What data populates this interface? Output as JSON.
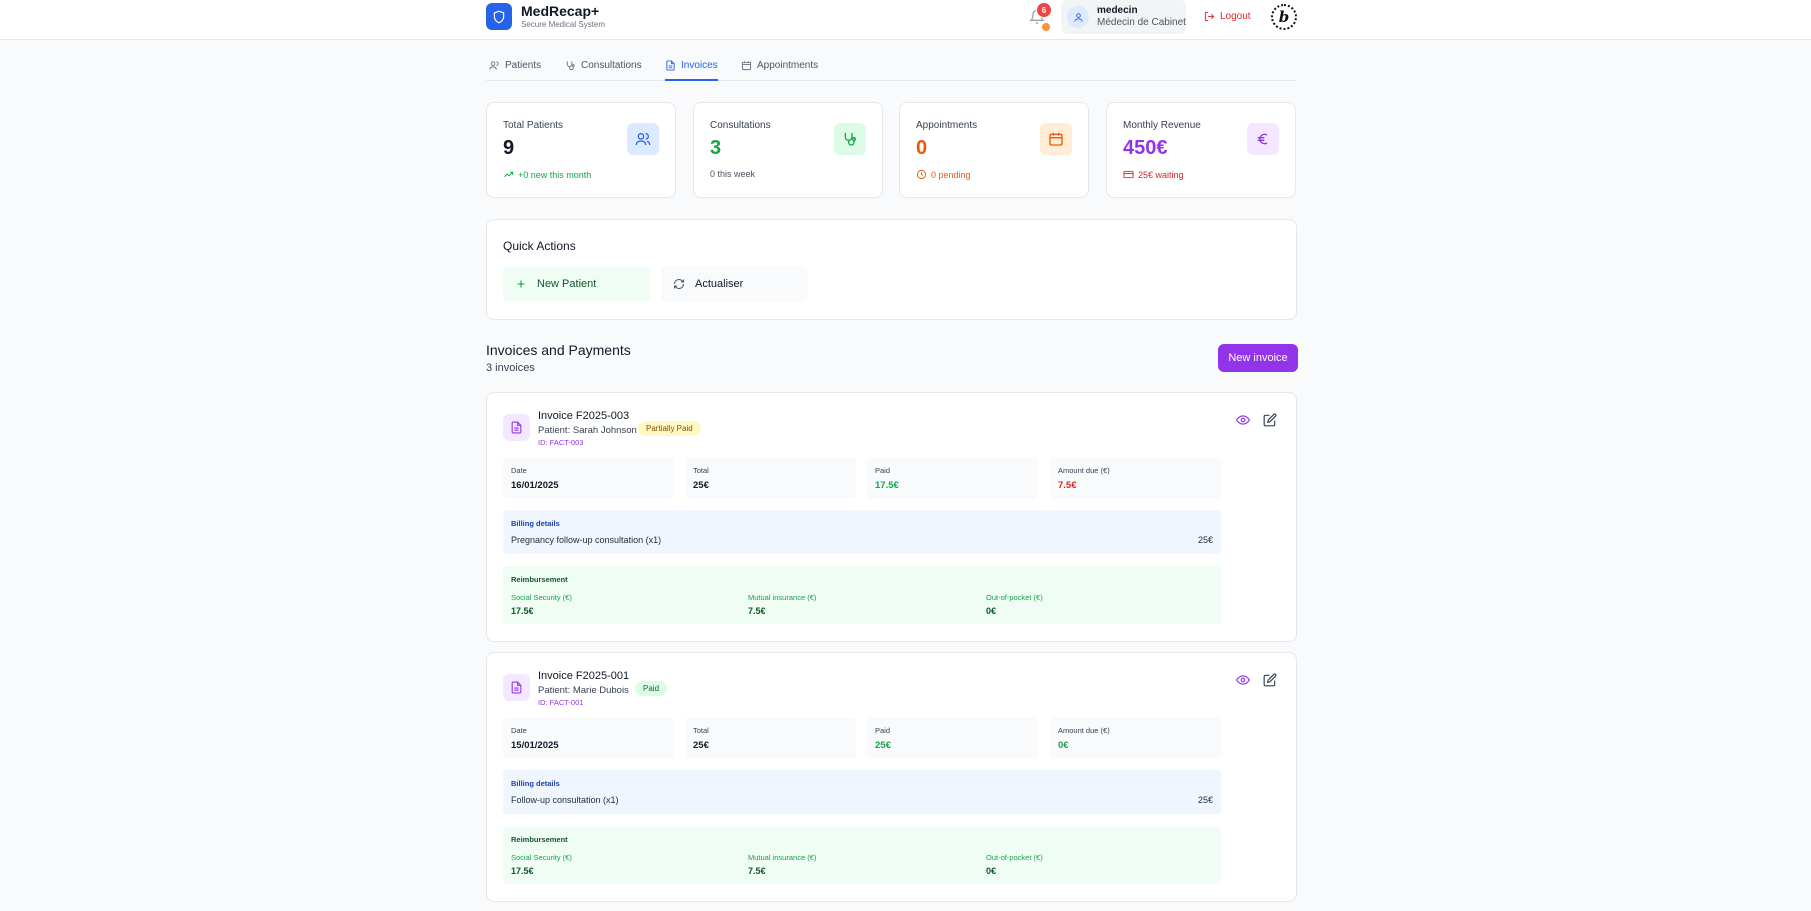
{
  "app": {
    "name": "MedRecap+",
    "subtitle": "Secure Medical System",
    "notification_count": "6"
  },
  "user": {
    "name": "medecin",
    "role": "Médecin de Cabinet",
    "logout_label": "Logout"
  },
  "tabs": [
    {
      "label": "Patients",
      "icon": "users-icon"
    },
    {
      "label": "Consultations",
      "icon": "stethoscope-icon"
    },
    {
      "label": "Invoices",
      "icon": "file-text-icon",
      "active": true
    },
    {
      "label": "Appointments",
      "icon": "calendar-icon"
    }
  ],
  "stats": [
    {
      "label": "Total Patients",
      "value": "9",
      "foot": "+0 new this month",
      "color": "#111827",
      "foot_color": "#16a34a"
    },
    {
      "label": "Consultations",
      "value": "3",
      "foot": "0 this week",
      "color": "#16a34a",
      "foot_color": "#4b5563"
    },
    {
      "label": "Appointments",
      "value": "0",
      "foot": "0 pending",
      "color": "#ea580c",
      "foot_color": "#ea580c"
    },
    {
      "label": "Monthly Revenue",
      "value": "450€",
      "foot": "25€ waiting",
      "color": "#9333ea",
      "foot_color": "#dc2626"
    }
  ],
  "quick_actions": {
    "title": "Quick Actions",
    "new_patient": "New Patient",
    "refresh": "Actualiser"
  },
  "invoices_section": {
    "title": "Invoices and Payments",
    "count": "3 invoices",
    "new_button": "New invoice"
  },
  "invoices": [
    {
      "number": "Invoice F2025-003",
      "patient": "Patient: Sarah Johnson",
      "id": "ID: FACT-003",
      "status": "Partially Paid",
      "date_label": "Date",
      "date": "16/01/2025",
      "total_label": "Total",
      "total": "25€",
      "paid_label": "Paid",
      "paid": "17.5€",
      "due_label": "Amount due (€)",
      "due": "7.5€",
      "billing_label": "Billing details",
      "billing_line": "Pregnancy follow-up consultation (x1)",
      "billing_amount": "25€",
      "reimb_label": "Reimbursement",
      "ss_label": "Social Security (€)",
      "ss": "17.5€",
      "mutual_label": "Mutual insurance (€)",
      "mutual": "7.5€",
      "oop_label": "Out-of-pocket (€)",
      "oop": "0€"
    },
    {
      "number": "Invoice F2025-001",
      "patient": "Patient: Marie Dubois",
      "id": "ID: FACT-001",
      "status": "Paid",
      "date_label": "Date",
      "date": "15/01/2025",
      "total_label": "Total",
      "total": "25€",
      "paid_label": "Paid",
      "paid": "25€",
      "due_label": "Amount due (€)",
      "due": "0€",
      "billing_label": "Billing details",
      "billing_line": "Follow-up consultation (x1)",
      "billing_amount": "25€",
      "reimb_label": "Reimbursement",
      "ss_label": "Social Security (€)",
      "ss": "17.5€",
      "mutual_label": "Mutual insurance (€)",
      "mutual": "7.5€",
      "oop_label": "Out-of-pocket (€)",
      "oop": "0€"
    }
  ]
}
